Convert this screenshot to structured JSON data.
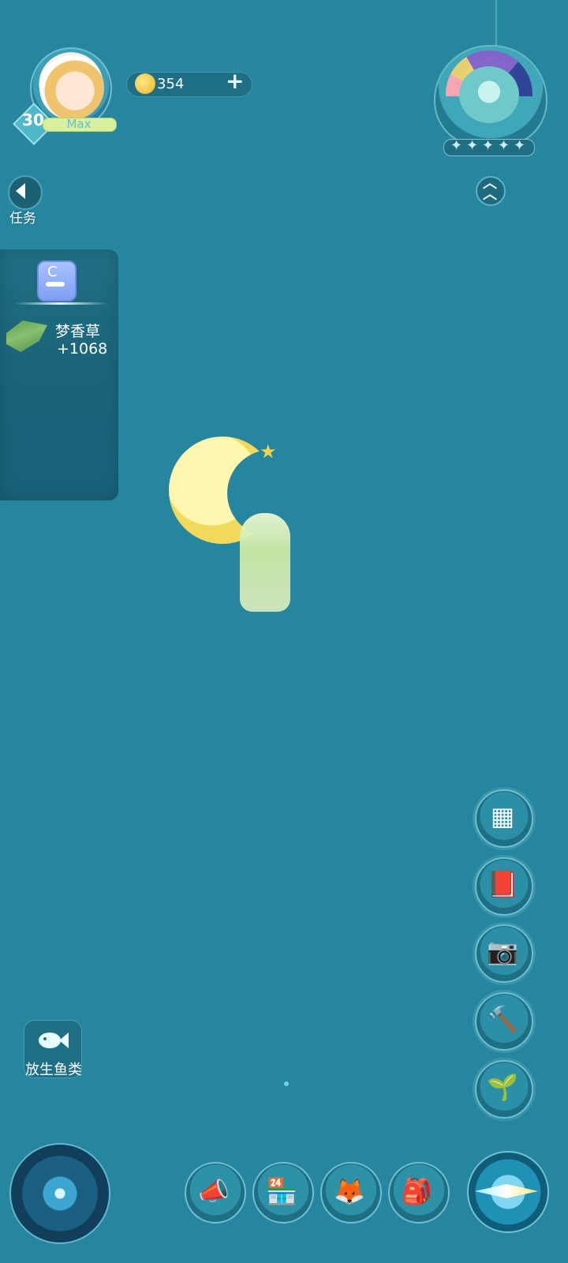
{
  "profile": {
    "level": "30",
    "level_state": "Max"
  },
  "currency": {
    "coins": "354",
    "add_label": "+"
  },
  "task": {
    "label": "任务"
  },
  "harvest": {
    "item_name": "梦香草",
    "item_gain": "+1068"
  },
  "bag_icon_letter": "C",
  "rank": {
    "stars": [
      "✦",
      "✦",
      "✦",
      "✦",
      "✦"
    ]
  },
  "fish": {
    "label": "放生鱼类"
  },
  "icons": {
    "right_menu": [
      "grid-moon-icon",
      "flower-book-icon",
      "camera-icon",
      "festival-hammer-icon",
      "sprout-icon"
    ],
    "bottom_bar": [
      "megaphone-icon",
      "shop-icon",
      "fox-icon",
      "backpack-icon"
    ],
    "compass": "compass-icon",
    "left_compass": "star-compass-icon"
  },
  "colors": {
    "background": "#27869f",
    "accent": "#6dc0d0",
    "coin": "#f0c63b",
    "moon": "#f1d95a"
  }
}
